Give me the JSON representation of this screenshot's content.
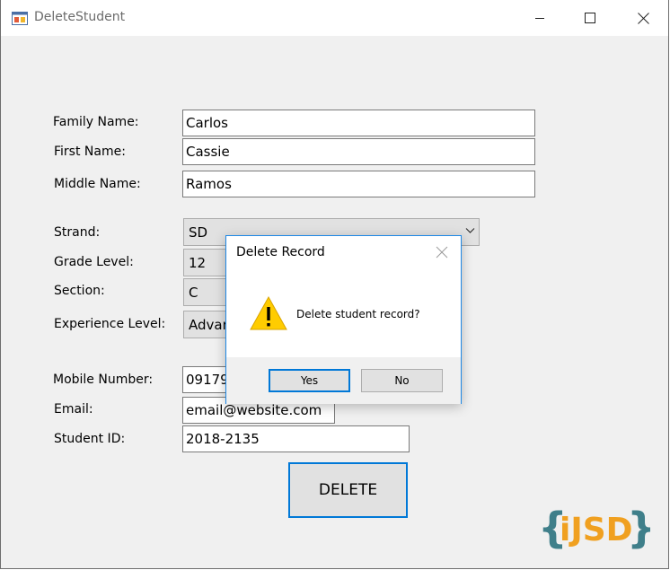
{
  "window": {
    "title": "DeleteStudent"
  },
  "form": {
    "family_name_label": "Family Name:",
    "family_name_value": "Carlos",
    "first_name_label": "First Name:",
    "first_name_value": "Cassie",
    "middle_name_label": "Middle Name:",
    "middle_name_value": "Ramos",
    "strand_label": "Strand:",
    "strand_value": "SD",
    "grade_level_label": "Grade Level:",
    "grade_level_value": "12",
    "section_label": "Section:",
    "section_value": "C",
    "experience_level_label": "Experience Level:",
    "experience_level_value": "Advan",
    "mobile_number_label": "Mobile Number:",
    "mobile_number_value": "0917984",
    "email_label": "Email:",
    "email_value": "email@website.com",
    "student_id_label": "Student ID:",
    "student_id_value": "2018-2135",
    "delete_button_label": "DELETE"
  },
  "dialog": {
    "title": "Delete Record",
    "message": "Delete student record?",
    "yes_label": "Yes",
    "no_label": "No",
    "icon": "warning-icon"
  },
  "logo": {
    "text": "iJSD",
    "open_brace": "{",
    "close_brace": "}"
  },
  "colors": {
    "accent": "#0078d7",
    "window_bg": "#f0f0f0",
    "warning": "#ffcc00",
    "logo_brace": "#3f7f8a",
    "logo_text": "#f0a020"
  }
}
